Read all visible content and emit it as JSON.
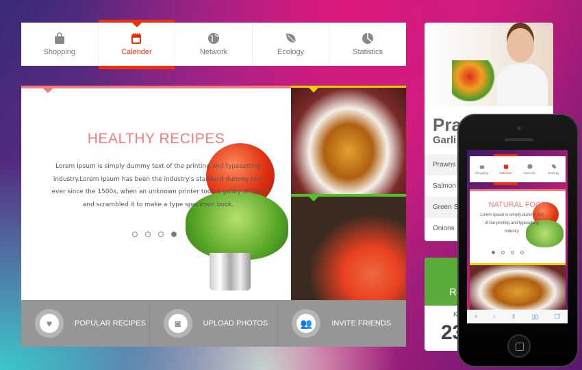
{
  "nav": {
    "tabs": [
      {
        "label": "Shopping",
        "icon": "shopping-bag-icon"
      },
      {
        "label": "Calender",
        "icon": "calendar-icon",
        "active": true
      },
      {
        "label": "Network",
        "icon": "globe-icon"
      },
      {
        "label": "Ecology",
        "icon": "leaf-icon"
      },
      {
        "label": "Statistics",
        "icon": "pie-chart-icon"
      }
    ]
  },
  "slider": {
    "title": "HEALTHY RECIPES",
    "text": "Lorem Ipsum is simply dummy text of the printing and typesetting industry.Lorem Ipsum has been the industry's standard dummy text ever since the 1500s, when an unknown printer took a galley of type and scrambled it to make a type specimen book.",
    "slide_count": 4,
    "active_slide": 4
  },
  "actions": [
    {
      "label": "POPULAR RECIPES",
      "icon": "heart-icon"
    },
    {
      "label": "UPLOAD PHOTOS",
      "icon": "camera-icon"
    },
    {
      "label": "INVITE FRIENDS",
      "icon": "users-icon"
    }
  ],
  "recipe_card": {
    "title": "Pra",
    "subtitle": "Garli",
    "ingredients": [
      "Prawns",
      "Salmon",
      "Green Sa",
      "Onions"
    ]
  },
  "stat_card": {
    "heading": "Ro",
    "label": "K",
    "value": "23"
  },
  "phone": {
    "tabs": [
      "Shopping",
      "Calender",
      "Network",
      "Ecology"
    ],
    "title": "NATURAL FOOD",
    "text": "Lorem Ipsum is simply dummy text of the printing and typesetting industry",
    "browser_icons": [
      "back-icon",
      "forward-icon",
      "share-icon",
      "bookmarks-icon",
      "tabs-icon"
    ]
  },
  "colors": {
    "accent": "#f0300a",
    "pink": "#f47b7b",
    "yellow": "#f3d200",
    "green": "#55c02a",
    "stat_green": "#5aab3a"
  }
}
